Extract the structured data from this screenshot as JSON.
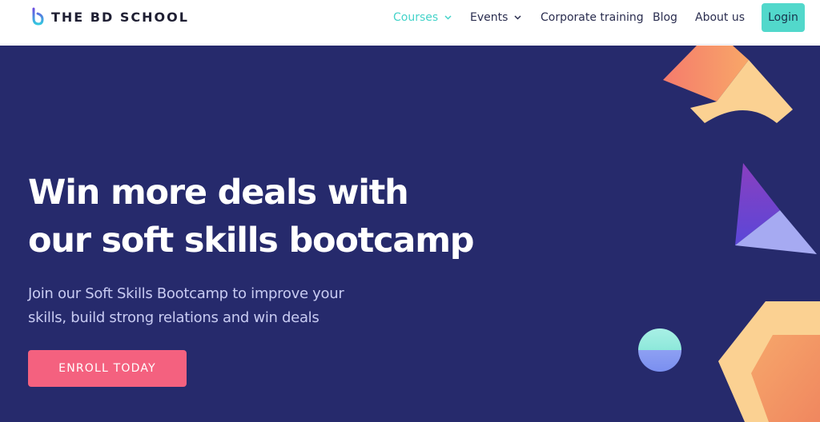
{
  "nav": {
    "brand": "THE BD SCHOOL",
    "items": [
      {
        "label": "Courses",
        "has_dropdown": true,
        "active": true
      },
      {
        "label": "Events",
        "has_dropdown": true,
        "active": false
      },
      {
        "label": "Corporate training",
        "has_dropdown": false,
        "active": false
      },
      {
        "label": "Blog",
        "has_dropdown": false,
        "active": false
      },
      {
        "label": "About us",
        "has_dropdown": false,
        "active": false
      }
    ],
    "login_label": "Login"
  },
  "hero": {
    "headline_lines": [
      "Win more deals with",
      "our soft skills bootcamp"
    ],
    "subtext_lines": [
      "Join our Soft Skills Bootcamp to improve your",
      "skills, build strong relations and win deals"
    ],
    "cta_label": "ENROLL TODAY"
  },
  "colors": {
    "hero_bg": "#262a6c",
    "accent_teal": "#52d8cb",
    "cta_pink": "#f4617f",
    "nav_text": "#2a2d4f"
  }
}
